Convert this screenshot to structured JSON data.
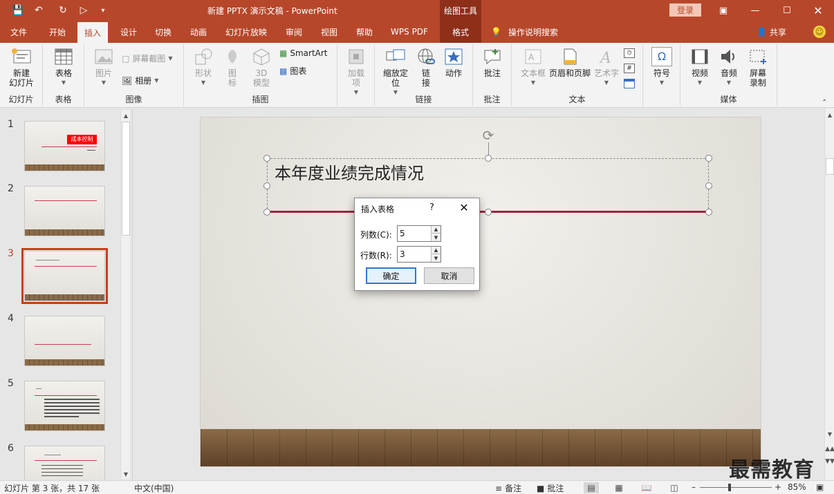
{
  "titlebar": {
    "doc_title": "新建 PPTX 演示文稿 - PowerPoint",
    "tools_label": "绘图工具",
    "login": "登录"
  },
  "tabs": [
    {
      "label": "文件"
    },
    {
      "label": "开始"
    },
    {
      "label": "插入",
      "active": true
    },
    {
      "label": "设计"
    },
    {
      "label": "切换"
    },
    {
      "label": "动画"
    },
    {
      "label": "幻灯片放映"
    },
    {
      "label": "审阅"
    },
    {
      "label": "视图"
    },
    {
      "label": "帮助"
    },
    {
      "label": "WPS PDF"
    },
    {
      "label": "格式"
    }
  ],
  "tell_me": "操作说明搜索",
  "share": "共享",
  "ribbon": {
    "new_slide": "新建\n幻灯片",
    "group_slides": "幻灯片",
    "table": "表格",
    "group_table": "表格",
    "picture": "图片",
    "screenshot": "屏幕截图",
    "album": "相册",
    "group_images": "图像",
    "shapes": "形状",
    "icons": "图\n标",
    "model_3d": "3D\n模型",
    "smartart": "SmartArt",
    "chart": "图表",
    "group_illustrations": "插图",
    "addins": "加载\n项",
    "zoom": "缩放定\n位",
    "link": "链\n接",
    "action": "动作",
    "group_links": "链接",
    "comment": "批注",
    "group_comments": "批注",
    "textbox": "文本框",
    "header_footer": "页眉和页脚",
    "wordart": "艺术字",
    "group_text": "文本",
    "symbol": "符号",
    "video": "视频",
    "audio": "音频",
    "screen_record": "屏幕\n录制",
    "group_media": "媒体"
  },
  "slides": [
    "1",
    "2",
    "3",
    "4",
    "5",
    "6"
  ],
  "thumb1_title": "成本控制",
  "slide": {
    "title": "本年度业绩完成情况"
  },
  "dialog": {
    "title": "插入表格",
    "help": "?",
    "columns_label": "列数(C):",
    "columns_value": "5",
    "rows_label": "行数(R):",
    "rows_value": "3",
    "ok": "确定",
    "cancel": "取消"
  },
  "status": {
    "slide_info": "幻灯片 第 3 张，共 17 张",
    "language": "中文(中国)",
    "notes": "备注",
    "comments": "批注",
    "zoom": "85%"
  },
  "watermark": "最需教育"
}
